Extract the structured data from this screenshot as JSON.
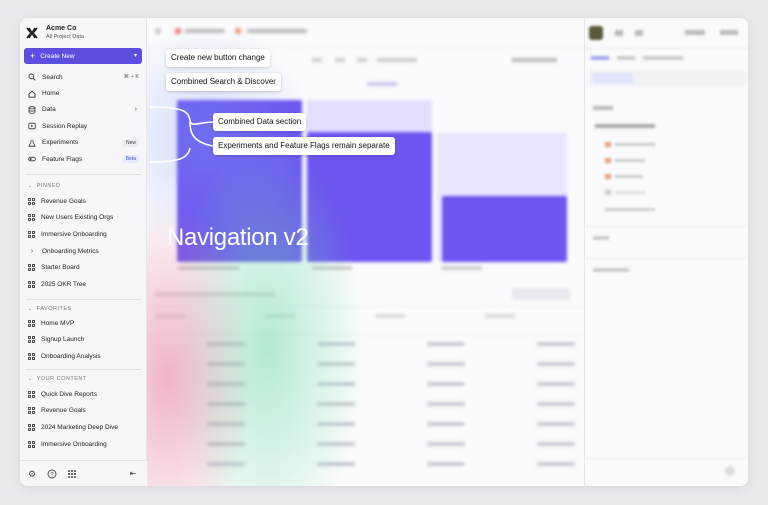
{
  "sidebar": {
    "org_name": "Acme Co",
    "org_sub": "All Project Data",
    "create_label": "Create New",
    "nav": [
      {
        "label": "Search",
        "icon": "search-icon",
        "kbd": "⌘ + K"
      },
      {
        "label": "Home",
        "icon": "home-icon"
      },
      {
        "label": "Data",
        "icon": "database-icon",
        "chevron": true
      },
      {
        "label": "Session Replay",
        "icon": "replay-icon"
      },
      {
        "label": "Experiments",
        "icon": "flask-icon",
        "badge": "New"
      },
      {
        "label": "Feature Flags",
        "icon": "toggle-icon",
        "badge": "Beta"
      }
    ],
    "sections": {
      "pinned": {
        "title": "PINNED",
        "items": [
          "Revenue Goals",
          "New Users Existing Orgs",
          "Immersive Onboarding",
          "Onboarding Metrics",
          "Starter Board",
          "2025 OKR Tree"
        ]
      },
      "favorites": {
        "title": "FAVORITES",
        "items": [
          "Home MVP",
          "Signup Launch",
          "Onboarding Analysis"
        ]
      },
      "your_content": {
        "title": "YOUR CONTENT",
        "items": [
          "Quick Dive Reports",
          "Revenue Goals",
          "2024 Marketing Deep Dive",
          "Immersive Onboarding"
        ]
      }
    },
    "footer_icons": [
      "gear-icon",
      "help-icon",
      "apps-grid-icon",
      "collapse-sidebar-icon"
    ]
  },
  "annotations": {
    "callout_1": "Create new button change",
    "callout_2": "Combined Search & Discover",
    "callout_3": "Combined Data section",
    "callout_4": "Experiments and Feature Flags remain separate",
    "title": "Navigation v2"
  },
  "colors": {
    "accent": "#5b4fe0",
    "bar_primary": "#6c55f0",
    "bar_light": "#e3deff"
  }
}
